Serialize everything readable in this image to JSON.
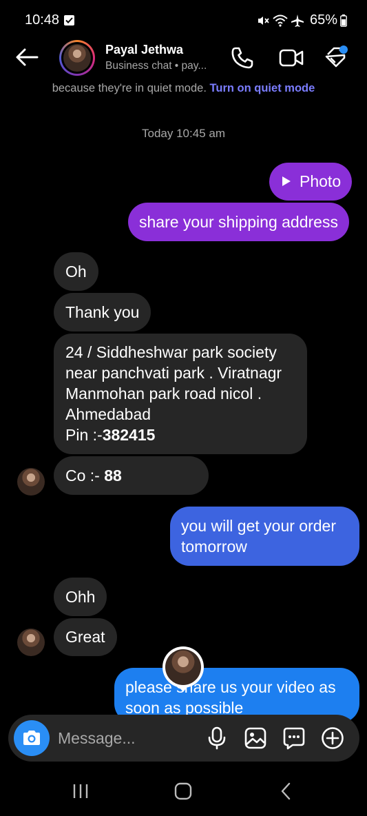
{
  "status_bar": {
    "time": "10:48",
    "battery": "65%"
  },
  "header": {
    "contact_name": "Payal Jethwa",
    "contact_subtitle": "Business chat • pay..."
  },
  "quiet_banner": {
    "text": "because they're in quiet mode.",
    "link": "Turn on quiet mode"
  },
  "timestamp": "Today 10:45 am",
  "messages": {
    "m1": {
      "text": "Photo"
    },
    "m2": {
      "text": "share your shipping address"
    },
    "m3": {
      "text": "Oh"
    },
    "m4": {
      "text": "Thank you"
    },
    "m5": {
      "line1": "24 / Siddheshwar park society",
      "line2": "near panchvati park . Viratnagr",
      "line3": "Manmohan park road nicol .",
      "line4": "Ahmedabad",
      "line5_label": "Pin :-",
      "line5_value": "382415"
    },
    "m6": {
      "label": "Co :- ",
      "value": "88"
    },
    "m7": {
      "line1": "you will get your order",
      "line2": "tomorrow"
    },
    "m8": {
      "text": "Ohh"
    },
    "m9": {
      "text": "Great"
    },
    "m10": {
      "line1": "please share us your video as",
      "line2": "soon as possible"
    }
  },
  "composer": {
    "placeholder": "Message..."
  },
  "colors": {
    "background": "#000000",
    "incoming_bubble": "#262626",
    "outgoing_purple": "#8a2fd8",
    "outgoing_blue": "#3d64e0",
    "outgoing_light_blue": "#1d7ff0",
    "link": "#7b7dff",
    "camera_button": "#2a8ef5"
  },
  "icons": {
    "back": "arrow-left-icon",
    "call": "phone-icon",
    "video": "video-camera-icon",
    "tag": "tag-icon",
    "camera": "camera-icon",
    "mic": "microphone-icon",
    "gallery": "image-icon",
    "sticker": "chat-sticker-icon",
    "plus": "plus-circle-icon"
  }
}
